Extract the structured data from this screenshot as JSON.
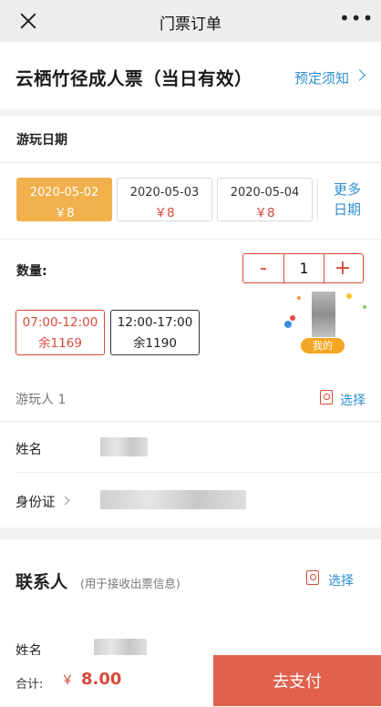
{
  "header": {
    "title": "门票订单",
    "more": "•••"
  },
  "ticket": {
    "name": "云栖竹径成人票（当日有效）",
    "notice_link": "预定须知"
  },
  "date_section": {
    "label": "游玩日期",
    "dates": [
      {
        "date": "2020-05-02",
        "price": "￥8",
        "selected": true
      },
      {
        "date": "2020-05-03",
        "price": "￥8",
        "selected": false
      },
      {
        "date": "2020-05-04",
        "price": "￥8",
        "selected": false
      }
    ],
    "more_line1": "更多",
    "more_line2": "日期"
  },
  "quantity": {
    "label": "数量:",
    "minus": "-",
    "value": "1",
    "plus": "+"
  },
  "time_slots": [
    {
      "time": "07:00-12:00",
      "remain": "余1169",
      "selected": true
    },
    {
      "time": "12:00-17:00",
      "remain": "余1190",
      "selected": false
    }
  ],
  "floating_badge": {
    "label": "我的"
  },
  "visitor": {
    "heading": "游玩人 1",
    "select": "选择",
    "name_label": "姓名",
    "id_label": "身份证"
  },
  "contact": {
    "title": "联系人",
    "subtitle": "(用于接收出票信息)",
    "select": "选择",
    "name_label": "姓名"
  },
  "footer": {
    "total_label": "合计:",
    "currency": "￥",
    "amount": "8.00",
    "pay_button": "去支付"
  },
  "colors": {
    "accent_red": "#d8493a",
    "link_blue": "#2f8fd0",
    "selected_date": "#f1b04c",
    "pay_button": "#e0614c"
  }
}
